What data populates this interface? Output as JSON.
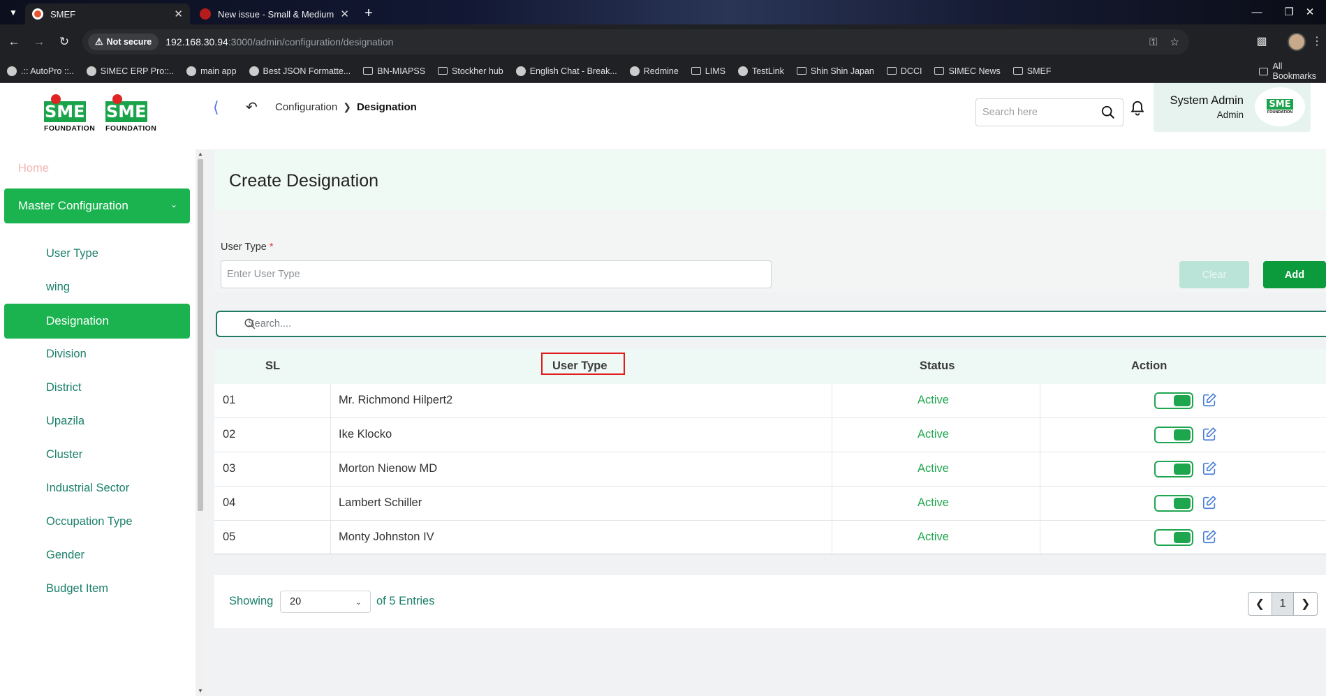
{
  "browser": {
    "tabs": [
      {
        "title": "SMEF",
        "active": true
      },
      {
        "title": "New issue - Small & Medium E",
        "active": false
      }
    ],
    "security_label": "Not secure",
    "url_host": "192.168.30.94",
    "url_path": ":3000/admin/configuration/designation",
    "bookmarks": [
      {
        "label": ".:: AutoPro ::..",
        "icon": "dot"
      },
      {
        "label": "SIMEC ERP Pro::..",
        "icon": "dot"
      },
      {
        "label": "main app",
        "icon": "dot"
      },
      {
        "label": "Best JSON Formatte...",
        "icon": "dot"
      },
      {
        "label": "BN-MIAPSS",
        "icon": "folder"
      },
      {
        "label": "Stockher hub",
        "icon": "folder"
      },
      {
        "label": "English Chat - Break...",
        "icon": "dot"
      },
      {
        "label": "Redmine",
        "icon": "dot"
      },
      {
        "label": "LIMS",
        "icon": "folder"
      },
      {
        "label": "TestLink",
        "icon": "dot"
      },
      {
        "label": "Shin Shin Japan",
        "icon": "folder"
      },
      {
        "label": "DCCI",
        "icon": "folder"
      },
      {
        "label": "SIMEC News",
        "icon": "folder"
      },
      {
        "label": "SMEF",
        "icon": "folder"
      }
    ],
    "all_bookmarks": "All Bookmarks"
  },
  "logo": {
    "word": "SME",
    "sub": "FOUNDATION"
  },
  "sidebar": {
    "home": "Home",
    "group": "Master Configuration",
    "items": [
      "User Type",
      "wing",
      "Designation",
      "Division",
      "District",
      "Upazila",
      "Cluster",
      "Industrial Sector",
      "Occupation Type",
      "Gender",
      "Budget Item"
    ],
    "active_index": 2
  },
  "header": {
    "breadcrumb_parent": "Configuration",
    "breadcrumb_current": "Designation",
    "search_placeholder": "Search here",
    "user_name": "System Admin",
    "user_role": "Admin",
    "user_logo_text": "SME",
    "user_logo_sub": "FOUNDATION"
  },
  "page": {
    "title": "Create Designation",
    "field_label": "User Type",
    "field_required": "*",
    "field_placeholder": "Enter User Type",
    "clear_label": "Clear",
    "add_label": "Add",
    "table_search_placeholder": "Search...."
  },
  "table": {
    "columns": [
      "SL",
      "User Type",
      "Status",
      "Action"
    ],
    "rows": [
      {
        "sl": "01",
        "user_type": "Mr. Richmond Hilpert2",
        "status": "Active"
      },
      {
        "sl": "02",
        "user_type": "Ike Klocko",
        "status": "Active"
      },
      {
        "sl": "03",
        "user_type": "Morton Nienow MD",
        "status": "Active"
      },
      {
        "sl": "04",
        "user_type": "Lambert Schiller",
        "status": "Active"
      },
      {
        "sl": "05",
        "user_type": "Monty Johnston IV",
        "status": "Active"
      }
    ]
  },
  "pagination": {
    "showing_label": "Showing",
    "page_size": "20",
    "entries_label": "of 5 Entries",
    "current_page": "1"
  },
  "colors": {
    "primary": "#1bb34f",
    "dark_green": "#0b9a3c",
    "teal_text": "#1a7f6a",
    "highlight_border": "#e21c1c"
  }
}
